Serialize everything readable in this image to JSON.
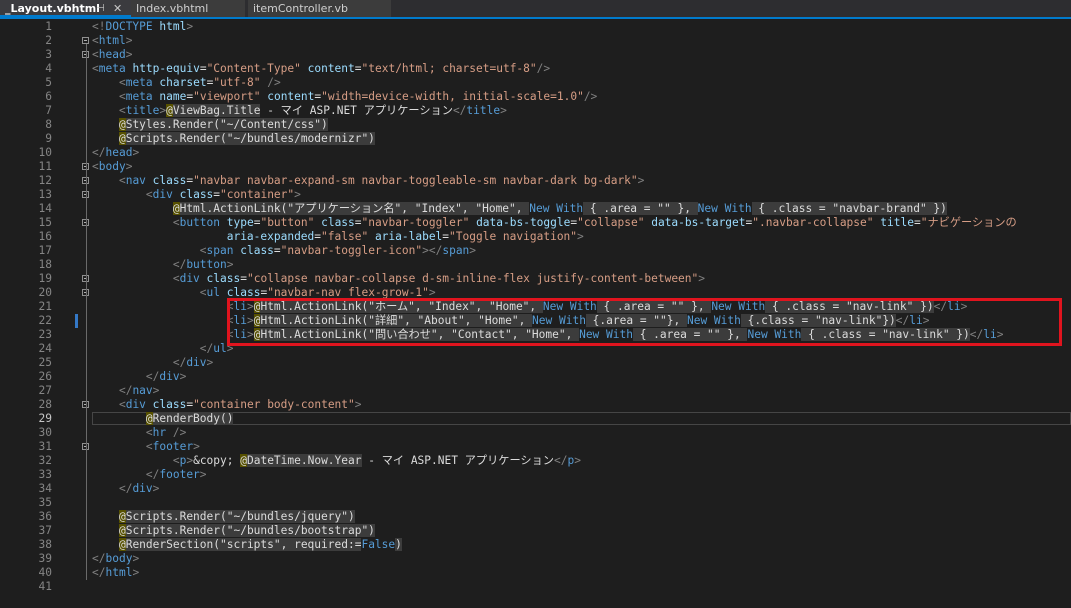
{
  "tabs": [
    {
      "label": "_Layout.vbhtml",
      "pin": "⊣",
      "close": "✕"
    },
    {
      "label": "Index.vbhtml"
    },
    {
      "label": "itemController.vb"
    }
  ],
  "current_line": 29,
  "modified_line": 22,
  "highlight_lines": [
    21,
    22,
    23
  ],
  "colors": {
    "accent": "#007acc",
    "highlight_box": "#e0141e",
    "keyword": "#569cd6",
    "attribute": "#9cdcfe",
    "string": "#d69d85"
  },
  "lines": [
    {
      "n": 1,
      "segs": [
        [
          "d",
          "<!"
        ],
        [
          "t",
          "DOCTYPE"
        ],
        [
          "p",
          " "
        ],
        [
          "a",
          "html"
        ],
        [
          "d",
          ">"
        ]
      ]
    },
    {
      "n": 2,
      "segs": [
        [
          "d",
          "<"
        ],
        [
          "t",
          "html"
        ],
        [
          "d",
          ">"
        ]
      ]
    },
    {
      "n": 3,
      "segs": [
        [
          "d",
          "<"
        ],
        [
          "t",
          "head"
        ],
        [
          "d",
          ">"
        ]
      ]
    },
    {
      "n": 4,
      "segs": [
        [
          "d",
          "<"
        ],
        [
          "t",
          "meta"
        ],
        [
          "p",
          " "
        ],
        [
          "a",
          "http-equiv"
        ],
        [
          "p",
          "="
        ],
        [
          "s",
          "\"Content-Type\""
        ],
        [
          "p",
          " "
        ],
        [
          "a",
          "content"
        ],
        [
          "p",
          "="
        ],
        [
          "s",
          "\"text/html; charset=utf-8\""
        ],
        [
          "d",
          "/>"
        ]
      ]
    },
    {
      "n": 5,
      "segs": [
        [
          "p",
          "    "
        ],
        [
          "d",
          "<"
        ],
        [
          "t",
          "meta"
        ],
        [
          "p",
          " "
        ],
        [
          "a",
          "charset"
        ],
        [
          "p",
          "="
        ],
        [
          "s",
          "\"utf-8\""
        ],
        [
          "p",
          " "
        ],
        [
          "d",
          "/>"
        ]
      ]
    },
    {
      "n": 6,
      "segs": [
        [
          "p",
          "    "
        ],
        [
          "d",
          "<"
        ],
        [
          "t",
          "meta"
        ],
        [
          "p",
          " "
        ],
        [
          "a",
          "name"
        ],
        [
          "p",
          "="
        ],
        [
          "s",
          "\"viewport\""
        ],
        [
          "p",
          " "
        ],
        [
          "a",
          "content"
        ],
        [
          "p",
          "="
        ],
        [
          "s",
          "\"width=device-width, initial-scale=1.0\""
        ],
        [
          "d",
          "/>"
        ]
      ]
    },
    {
      "n": 7,
      "segs": [
        [
          "p",
          "    "
        ],
        [
          "d",
          "<"
        ],
        [
          "t",
          "title"
        ],
        [
          "d",
          ">"
        ],
        [
          "at",
          "@"
        ],
        [
          "hl",
          "ViewBag.Title"
        ],
        [
          "p",
          " - マイ ASP.NET アプリケーション"
        ],
        [
          "d",
          "</"
        ],
        [
          "t",
          "title"
        ],
        [
          "d",
          ">"
        ]
      ]
    },
    {
      "n": 8,
      "segs": [
        [
          "p",
          "    "
        ],
        [
          "at",
          "@"
        ],
        [
          "hl",
          "Styles.Render(\"~/Content/css\")"
        ]
      ]
    },
    {
      "n": 9,
      "segs": [
        [
          "p",
          "    "
        ],
        [
          "at",
          "@"
        ],
        [
          "hl",
          "Scripts.Render(\"~/bundles/modernizr\")"
        ]
      ]
    },
    {
      "n": 10,
      "segs": [
        [
          "d",
          "</"
        ],
        [
          "t",
          "head"
        ],
        [
          "d",
          ">"
        ]
      ]
    },
    {
      "n": 11,
      "segs": [
        [
          "d",
          "<"
        ],
        [
          "t",
          "body"
        ],
        [
          "d",
          ">"
        ]
      ]
    },
    {
      "n": 12,
      "segs": [
        [
          "p",
          "    "
        ],
        [
          "d",
          "<"
        ],
        [
          "t",
          "nav"
        ],
        [
          "p",
          " "
        ],
        [
          "a",
          "class"
        ],
        [
          "p",
          "="
        ],
        [
          "s",
          "\"navbar navbar-expand-sm navbar-toggleable-sm navbar-dark bg-dark\""
        ],
        [
          "d",
          ">"
        ]
      ]
    },
    {
      "n": 13,
      "segs": [
        [
          "p",
          "        "
        ],
        [
          "d",
          "<"
        ],
        [
          "t",
          "div"
        ],
        [
          "p",
          " "
        ],
        [
          "a",
          "class"
        ],
        [
          "p",
          "="
        ],
        [
          "s",
          "\"container\""
        ],
        [
          "d",
          ">"
        ]
      ]
    },
    {
      "n": 14,
      "segs": [
        [
          "p",
          "            "
        ],
        [
          "at",
          "@"
        ],
        [
          "hl",
          "Html.ActionLink(\"アプリケーション名\", \"Index\", \"Home\", "
        ],
        [
          "k",
          "New With"
        ],
        [
          "hl",
          " { .area = \"\" }, "
        ],
        [
          "k",
          "New With"
        ],
        [
          "hl",
          " { .class = \"navbar-brand\" })"
        ]
      ]
    },
    {
      "n": 15,
      "segs": [
        [
          "p",
          "            "
        ],
        [
          "d",
          "<"
        ],
        [
          "t",
          "button"
        ],
        [
          "p",
          " "
        ],
        [
          "a",
          "type"
        ],
        [
          "p",
          "="
        ],
        [
          "s",
          "\"button\""
        ],
        [
          "p",
          " "
        ],
        [
          "a",
          "class"
        ],
        [
          "p",
          "="
        ],
        [
          "s",
          "\"navbar-toggler\""
        ],
        [
          "p",
          " "
        ],
        [
          "a",
          "data-bs-toggle"
        ],
        [
          "p",
          "="
        ],
        [
          "s",
          "\"collapse\""
        ],
        [
          "p",
          " "
        ],
        [
          "a",
          "data-bs-target"
        ],
        [
          "p",
          "="
        ],
        [
          "s",
          "\".navbar-collapse\""
        ],
        [
          "p",
          " "
        ],
        [
          "a",
          "title"
        ],
        [
          "p",
          "="
        ],
        [
          "s",
          "\"ナビゲーションの"
        ]
      ]
    },
    {
      "n": 16,
      "segs": [
        [
          "p",
          "                    "
        ],
        [
          "a",
          "aria-expanded"
        ],
        [
          "p",
          "="
        ],
        [
          "s",
          "\"false\""
        ],
        [
          "p",
          " "
        ],
        [
          "a",
          "aria-label"
        ],
        [
          "p",
          "="
        ],
        [
          "s",
          "\"Toggle navigation\""
        ],
        [
          "d",
          ">"
        ]
      ]
    },
    {
      "n": 17,
      "segs": [
        [
          "p",
          "                "
        ],
        [
          "d",
          "<"
        ],
        [
          "t",
          "span"
        ],
        [
          "p",
          " "
        ],
        [
          "a",
          "class"
        ],
        [
          "p",
          "="
        ],
        [
          "s",
          "\"navbar-toggler-icon\""
        ],
        [
          "d",
          "></"
        ],
        [
          "t",
          "span"
        ],
        [
          "d",
          ">"
        ]
      ]
    },
    {
      "n": 18,
      "segs": [
        [
          "p",
          "            "
        ],
        [
          "d",
          "</"
        ],
        [
          "t",
          "button"
        ],
        [
          "d",
          ">"
        ]
      ]
    },
    {
      "n": 19,
      "segs": [
        [
          "p",
          "            "
        ],
        [
          "d",
          "<"
        ],
        [
          "t",
          "div"
        ],
        [
          "p",
          " "
        ],
        [
          "a",
          "class"
        ],
        [
          "p",
          "="
        ],
        [
          "s",
          "\"collapse navbar-collapse d-sm-inline-flex justify-content-between\""
        ],
        [
          "d",
          ">"
        ]
      ]
    },
    {
      "n": 20,
      "segs": [
        [
          "p",
          "                "
        ],
        [
          "d",
          "<"
        ],
        [
          "t",
          "ul"
        ],
        [
          "p",
          " "
        ],
        [
          "a",
          "class"
        ],
        [
          "p",
          "="
        ],
        [
          "s",
          "\"navbar-nav flex-grow-1\""
        ],
        [
          "d",
          ">"
        ]
      ]
    },
    {
      "n": 21,
      "segs": [
        [
          "p",
          "                    "
        ],
        [
          "d",
          "<"
        ],
        [
          "t",
          "li"
        ],
        [
          "d",
          ">"
        ],
        [
          "at",
          "@"
        ],
        [
          "hl",
          "Html.ActionLink(\"ホーム\", \"Index\", \"Home\", "
        ],
        [
          "k",
          "New With"
        ],
        [
          "hl",
          " { .area = \"\" }, "
        ],
        [
          "k",
          "New With"
        ],
        [
          "hl",
          " { .class = \"nav-link\" })"
        ],
        [
          "d",
          "</"
        ],
        [
          "t",
          "li"
        ],
        [
          "d",
          ">"
        ]
      ]
    },
    {
      "n": 22,
      "segs": [
        [
          "p",
          "                    "
        ],
        [
          "d",
          "<"
        ],
        [
          "t",
          "li"
        ],
        [
          "d",
          ">"
        ],
        [
          "at",
          "@"
        ],
        [
          "hl",
          "Html.ActionLink(\"詳細\", \"About\", \"Home\", "
        ],
        [
          "k",
          "New With"
        ],
        [
          "hl",
          " {.area = \"\"}, "
        ],
        [
          "k",
          "New With"
        ],
        [
          "hl",
          " {.class = \"nav-link\"})"
        ],
        [
          "d",
          "</"
        ],
        [
          "t",
          "li"
        ],
        [
          "d",
          ">"
        ]
      ]
    },
    {
      "n": 23,
      "segs": [
        [
          "p",
          "                    "
        ],
        [
          "d",
          "<"
        ],
        [
          "t",
          "li"
        ],
        [
          "d",
          ">"
        ],
        [
          "at",
          "@"
        ],
        [
          "hl",
          "Html.ActionLink(\"問い合わせ\", \"Contact\", \"Home\", "
        ],
        [
          "k",
          "New With"
        ],
        [
          "hl",
          " { .area = \"\" }, "
        ],
        [
          "k",
          "New With"
        ],
        [
          "hl",
          " { .class = \"nav-link\" })"
        ],
        [
          "d",
          "</"
        ],
        [
          "t",
          "li"
        ],
        [
          "d",
          ">"
        ]
      ]
    },
    {
      "n": 24,
      "segs": [
        [
          "p",
          "                "
        ],
        [
          "d",
          "</"
        ],
        [
          "t",
          "ul"
        ],
        [
          "d",
          ">"
        ]
      ]
    },
    {
      "n": 25,
      "segs": [
        [
          "p",
          "            "
        ],
        [
          "d",
          "</"
        ],
        [
          "t",
          "div"
        ],
        [
          "d",
          ">"
        ]
      ]
    },
    {
      "n": 26,
      "segs": [
        [
          "p",
          "        "
        ],
        [
          "d",
          "</"
        ],
        [
          "t",
          "div"
        ],
        [
          "d",
          ">"
        ]
      ]
    },
    {
      "n": 27,
      "segs": [
        [
          "p",
          "    "
        ],
        [
          "d",
          "</"
        ],
        [
          "t",
          "nav"
        ],
        [
          "d",
          ">"
        ]
      ]
    },
    {
      "n": 28,
      "segs": [
        [
          "p",
          "    "
        ],
        [
          "d",
          "<"
        ],
        [
          "t",
          "div"
        ],
        [
          "p",
          " "
        ],
        [
          "a",
          "class"
        ],
        [
          "p",
          "="
        ],
        [
          "s",
          "\"container body-content\""
        ],
        [
          "d",
          ">"
        ]
      ]
    },
    {
      "n": 29,
      "segs": [
        [
          "p",
          "        "
        ],
        [
          "at",
          "@"
        ],
        [
          "hl",
          "RenderBody()"
        ]
      ]
    },
    {
      "n": 30,
      "segs": [
        [
          "p",
          "        "
        ],
        [
          "d",
          "<"
        ],
        [
          "t",
          "hr"
        ],
        [
          "p",
          " "
        ],
        [
          "d",
          "/>"
        ]
      ]
    },
    {
      "n": 31,
      "segs": [
        [
          "p",
          "        "
        ],
        [
          "d",
          "<"
        ],
        [
          "t",
          "footer"
        ],
        [
          "d",
          ">"
        ]
      ]
    },
    {
      "n": 32,
      "segs": [
        [
          "p",
          "            "
        ],
        [
          "d",
          "<"
        ],
        [
          "t",
          "p"
        ],
        [
          "d",
          ">"
        ],
        [
          "p",
          "&copy; "
        ],
        [
          "at",
          "@"
        ],
        [
          "hl",
          "DateTime.Now.Year"
        ],
        [
          "p",
          " - マイ ASP.NET アプリケーション"
        ],
        [
          "d",
          "</"
        ],
        [
          "t",
          "p"
        ],
        [
          "d",
          ">"
        ]
      ]
    },
    {
      "n": 33,
      "segs": [
        [
          "p",
          "        "
        ],
        [
          "d",
          "</"
        ],
        [
          "t",
          "footer"
        ],
        [
          "d",
          ">"
        ]
      ]
    },
    {
      "n": 34,
      "segs": [
        [
          "p",
          "    "
        ],
        [
          "d",
          "</"
        ],
        [
          "t",
          "div"
        ],
        [
          "d",
          ">"
        ]
      ]
    },
    {
      "n": 35,
      "segs": []
    },
    {
      "n": 36,
      "segs": [
        [
          "p",
          "    "
        ],
        [
          "at",
          "@"
        ],
        [
          "hl",
          "Scripts.Render(\"~/bundles/jquery\")"
        ]
      ]
    },
    {
      "n": 37,
      "segs": [
        [
          "p",
          "    "
        ],
        [
          "at",
          "@"
        ],
        [
          "hl",
          "Scripts.Render(\"~/bundles/bootstrap\")"
        ]
      ]
    },
    {
      "n": 38,
      "segs": [
        [
          "p",
          "    "
        ],
        [
          "at",
          "@"
        ],
        [
          "hl",
          "RenderSection(\"scripts\", required:="
        ],
        [
          "k",
          "False"
        ],
        [
          "hl",
          ")"
        ]
      ]
    },
    {
      "n": 39,
      "segs": [
        [
          "d",
          "</"
        ],
        [
          "t",
          "body"
        ],
        [
          "d",
          ">"
        ]
      ]
    },
    {
      "n": 40,
      "segs": [
        [
          "d",
          "</"
        ],
        [
          "t",
          "html"
        ],
        [
          "d",
          ">"
        ]
      ]
    },
    {
      "n": 41,
      "segs": []
    }
  ],
  "fold_lines": [
    2,
    3,
    11,
    12,
    13,
    15,
    19,
    20,
    28,
    31
  ]
}
